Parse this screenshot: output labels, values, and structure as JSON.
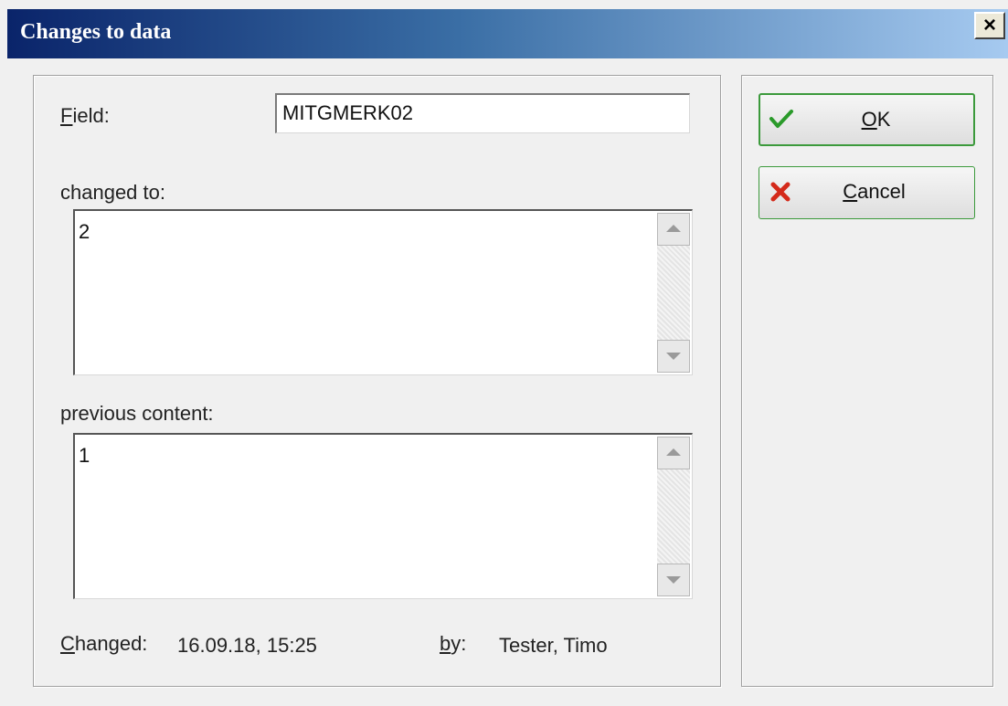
{
  "window": {
    "title": "Changes to data",
    "close_label": "×"
  },
  "field": {
    "label_mnemonic": "F",
    "label_rest": "ield:",
    "value": "MITGMERK02"
  },
  "changed_to": {
    "label": "changed to:",
    "value": "2"
  },
  "previous_content": {
    "label": "previous content:",
    "value": "1"
  },
  "status": {
    "changed_mnemonic": "C",
    "changed_rest": "hanged:",
    "changed_value": "16.09.18, 15:25",
    "by_mnemonic": "b",
    "by_rest": "y:",
    "by_value": "Tester, Timo"
  },
  "buttons": {
    "ok_mnemonic": "O",
    "ok_rest": "K",
    "ok_icon": "checkmark-icon",
    "cancel_mnemonic": "C",
    "cancel_rest": "ancel",
    "cancel_icon": "cross-icon"
  },
  "colors": {
    "titlebar_start": "#0a246a",
    "titlebar_end": "#a6caf0",
    "button_border": "#3c9a3c",
    "cancel_icon": "#d42a1a",
    "ok_icon": "#2a9a2a"
  }
}
